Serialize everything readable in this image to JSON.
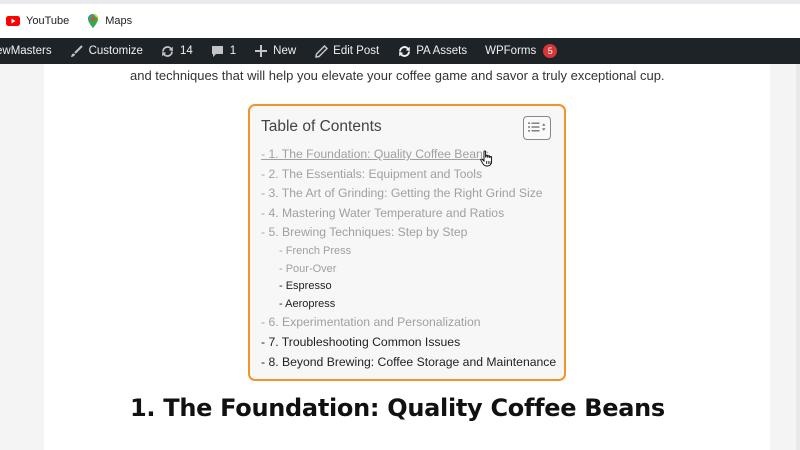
{
  "bookmarks": [
    {
      "label": "YouTube",
      "icon": "youtube-icon"
    },
    {
      "label": "Maps",
      "icon": "maps-icon"
    }
  ],
  "admin_bar": {
    "site_name": "ewMasters",
    "customize": "Customize",
    "updates_count": "14",
    "comments_count": "1",
    "new": "New",
    "edit_post": "Edit Post",
    "pa_assets": "PA Assets",
    "wpforms": "WPForms",
    "wpforms_badge": "5"
  },
  "article": {
    "intro_text": "and techniques that will help you elevate your coffee game and savor a truly exceptional cup.",
    "heading": "1. The Foundation: Quality Coffee Beans"
  },
  "toc": {
    "title": "Table of Contents",
    "items": [
      {
        "label": "- 1. The Foundation: Quality Coffee Beans"
      },
      {
        "label": "- 2. The Essentials: Equipment and Tools"
      },
      {
        "label": "- 3. The Art of Grinding: Getting the Right Grind Size"
      },
      {
        "label": "- 4. Mastering Water Temperature and Ratios"
      },
      {
        "label": "- 5. Brewing Techniques: Step by Step"
      },
      {
        "label": "- French Press"
      },
      {
        "label": "- Pour-Over"
      },
      {
        "label": "- Espresso"
      },
      {
        "label": "- Aeropress"
      },
      {
        "label": "- 6. Experimentation and Personalization"
      },
      {
        "label": "- 7. Troubleshooting Common Issues"
      },
      {
        "label": "- 8. Beyond Brewing: Coffee Storage and Maintenance"
      }
    ]
  },
  "colors": {
    "admin_bar_bg": "#1d2327",
    "toc_border": "#f0952b",
    "badge": "#d63638"
  }
}
